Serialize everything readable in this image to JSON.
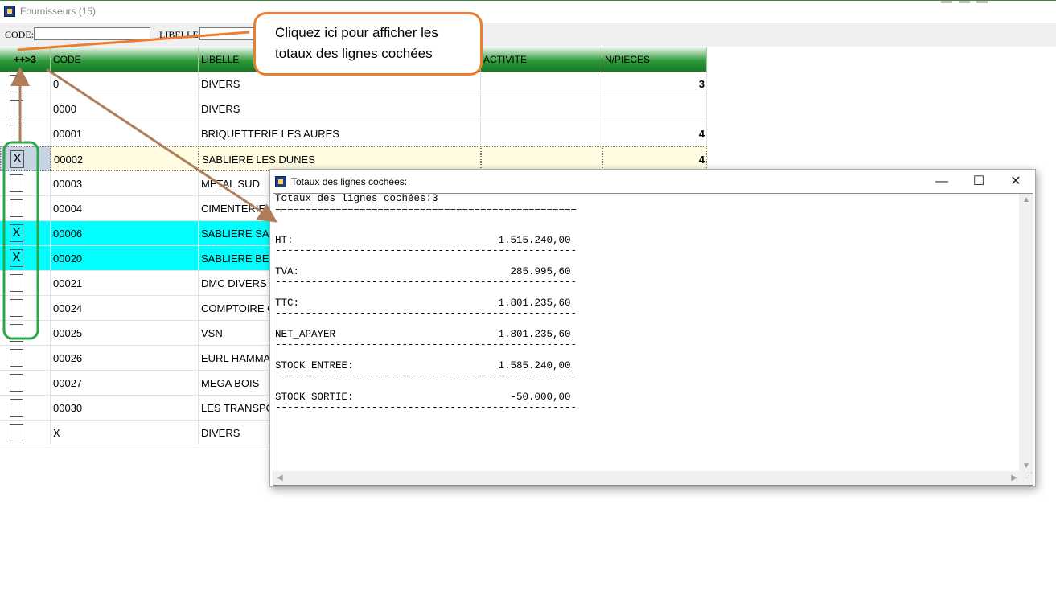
{
  "window": {
    "title": "Fournisseurs (15)"
  },
  "filter": {
    "code_label": "CODE:",
    "code_value": "",
    "libelle_label": "LIBELLE",
    "libelle_value": ""
  },
  "grid": {
    "headers": [
      "++>3",
      "CODE",
      "LIBELLE",
      "ACTIVITE",
      "N/PIECES"
    ],
    "rows": [
      {
        "checked": "",
        "code": "0",
        "libelle": "DIVERS",
        "activite": "",
        "npieces": "3"
      },
      {
        "checked": "",
        "code": "0000",
        "libelle": "DIVERS",
        "activite": "",
        "npieces": ""
      },
      {
        "checked": "",
        "code": "00001",
        "libelle": "BRIQUETTERIE LES AURES",
        "activite": "",
        "npieces": "4"
      },
      {
        "checked": "X",
        "code": "00002",
        "libelle": "SABLIERE LES DUNES",
        "activite": "",
        "npieces": "4"
      },
      {
        "checked": "",
        "code": "00003",
        "libelle": "METAL SUD",
        "activite": "",
        "npieces": ""
      },
      {
        "checked": "",
        "code": "00004",
        "libelle": "CIMENTERIE",
        "activite": "",
        "npieces": ""
      },
      {
        "checked": "X",
        "code": "00006",
        "libelle": "SABLIERE SA",
        "activite": "",
        "npieces": ""
      },
      {
        "checked": "X",
        "code": "00020",
        "libelle": "SABLIERE BE",
        "activite": "",
        "npieces": ""
      },
      {
        "checked": "",
        "code": "00021",
        "libelle": "DMC DIVERS I",
        "activite": "",
        "npieces": ""
      },
      {
        "checked": "",
        "code": "00024",
        "libelle": "COMPTOIRE C",
        "activite": "",
        "npieces": ""
      },
      {
        "checked": "",
        "code": "00025",
        "libelle": "VSN",
        "activite": "",
        "npieces": ""
      },
      {
        "checked": "",
        "code": "00026",
        "libelle": "EURL  HAMMA",
        "activite": "",
        "npieces": ""
      },
      {
        "checked": "",
        "code": "00027",
        "libelle": "MEGA BOIS",
        "activite": "",
        "npieces": ""
      },
      {
        "checked": "",
        "code": "00030",
        "libelle": "LES TRANSPO",
        "activite": "",
        "npieces": ""
      },
      {
        "checked": "",
        "code": "X",
        "libelle": "DIVERS",
        "activite": "",
        "npieces": ""
      }
    ]
  },
  "callout": {
    "text": "Cliquez ici pour afficher les totaux des lignes cochées",
    "color": "#ed7d31"
  },
  "dialog": {
    "title": "Totaux des lignes cochées:",
    "controls": {
      "minimize": "—",
      "maximize": "☐",
      "close": "✕"
    },
    "lines": [
      "Totaux des lignes cochées:3",
      "==================================================",
      "",
      "HT:                                  1.515.240,00",
      "--------------------------------------------------",
      "TVA:                                   285.995,60",
      "--------------------------------------------------",
      "TTC:                                 1.801.235,60",
      "--------------------------------------------------",
      "NET_APAYER                           1.801.235,60",
      "--------------------------------------------------",
      "STOCK ENTREE:                        1.585.240,00",
      "--------------------------------------------------",
      "STOCK SORTIE:                          -50.000,00",
      "--------------------------------------------------"
    ]
  },
  "colors": {
    "header_green": "#2f9a3a",
    "highlight": "#00ffff",
    "selected_row": "#fffce1",
    "annotation_green": "#2aa84a",
    "arrow_brown": "#b07d5a"
  }
}
